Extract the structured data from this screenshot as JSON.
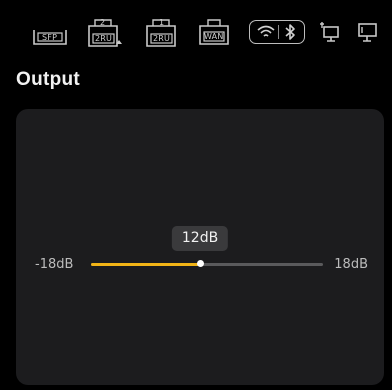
{
  "statusbar": {
    "icons": [
      {
        "name": "sfp-port-icon",
        "label": "SFP"
      },
      {
        "name": "2ru-unit-2-icon",
        "label": "2RU",
        "number": "2"
      },
      {
        "name": "2ru-unit-1-icon",
        "label": "2RU",
        "number": "1"
      },
      {
        "name": "wan-port-icon",
        "label": "WAN"
      },
      {
        "name": "wifi-icon"
      },
      {
        "name": "bluetooth-icon"
      },
      {
        "name": "usb-pc-icon"
      },
      {
        "name": "monitor-icon"
      }
    ]
  },
  "output": {
    "title": "Output",
    "min_label": "-18dB",
    "max_label": "18dB",
    "value_label": "12dB",
    "min": -18,
    "max": 18,
    "value_fraction": 0.47
  },
  "colors": {
    "background": "#000000",
    "card": "#1c1c1e",
    "accent": "#f2b417",
    "track": "#5a5a5c",
    "bubble": "#3a3a3c"
  }
}
